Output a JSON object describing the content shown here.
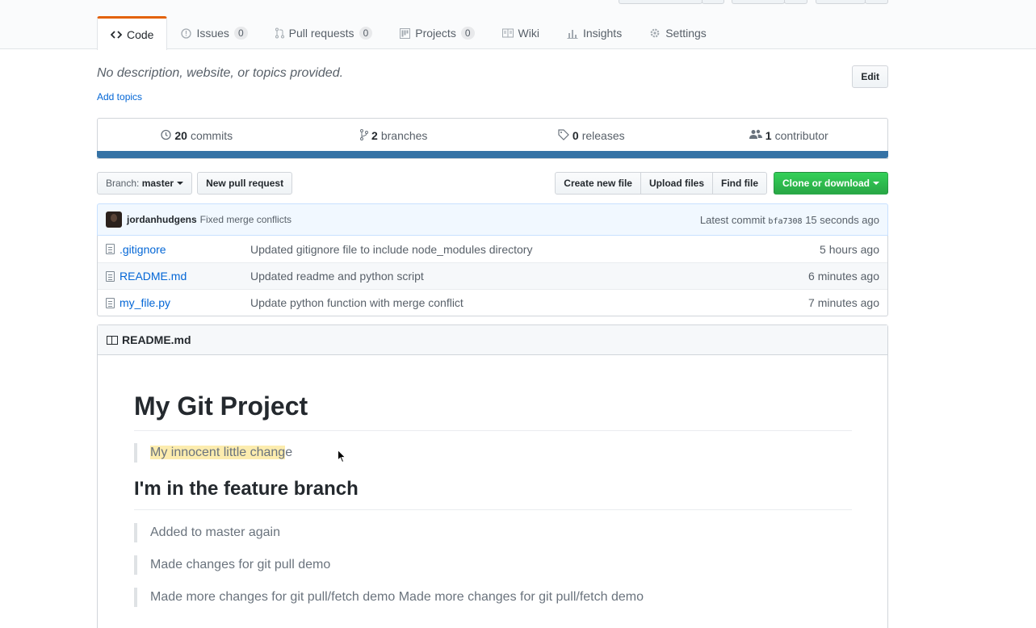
{
  "tabs": [
    {
      "label": "Code",
      "icon": "code-icon",
      "count": null
    },
    {
      "label": "Issues",
      "icon": "issue-icon",
      "count": "0"
    },
    {
      "label": "Pull requests",
      "icon": "pull-request-icon",
      "count": "0"
    },
    {
      "label": "Projects",
      "icon": "project-icon",
      "count": "0"
    },
    {
      "label": "Wiki",
      "icon": "book-icon",
      "count": null
    },
    {
      "label": "Insights",
      "icon": "graph-icon",
      "count": null
    },
    {
      "label": "Settings",
      "icon": "gear-icon",
      "count": null
    }
  ],
  "repo": {
    "description": "No description, website, or topics provided.",
    "add_topics": "Add topics",
    "edit_label": "Edit"
  },
  "summary": {
    "commits_count": "20",
    "commits_label": "commits",
    "branches_count": "2",
    "branches_label": "branches",
    "releases_count": "0",
    "releases_label": "releases",
    "contributors_count": "1",
    "contributors_label": "contributor"
  },
  "language_color": "#3572A5",
  "file_nav": {
    "branch_prefix": "Branch:",
    "branch_name": "master",
    "new_pr": "New pull request",
    "create_file": "Create new file",
    "upload_files": "Upload files",
    "find_file": "Find file",
    "clone": "Clone or download"
  },
  "latest_commit": {
    "author": "jordanhudgens",
    "message": "Fixed merge conflicts",
    "prefix": "Latest commit",
    "sha": "bfa7308",
    "age": "15 seconds ago"
  },
  "files": [
    {
      "name": ".gitignore",
      "message": "Updated gitignore file to include node_modules directory",
      "age": "5 hours ago"
    },
    {
      "name": "README.md",
      "message": "Updated readme and python script",
      "age": "6 minutes ago"
    },
    {
      "name": "my_file.py",
      "message": "Update python function with merge conflict",
      "age": "7 minutes ago"
    }
  ],
  "readme": {
    "filename": "README.md",
    "h1": "My Git Project",
    "quote1_highlight": "My innocent little chang",
    "quote1_rest": "e",
    "h2": "I'm in the feature branch",
    "quotes": [
      "Added to master again",
      "Made changes for git pull demo",
      "Made more changes for git pull/fetch demo Made more changes for git pull/fetch demo"
    ]
  },
  "colors": {
    "accent_tab": "#e36209",
    "link": "#0366d6",
    "green_button": "#28a745",
    "highlight": "#fcecae"
  }
}
